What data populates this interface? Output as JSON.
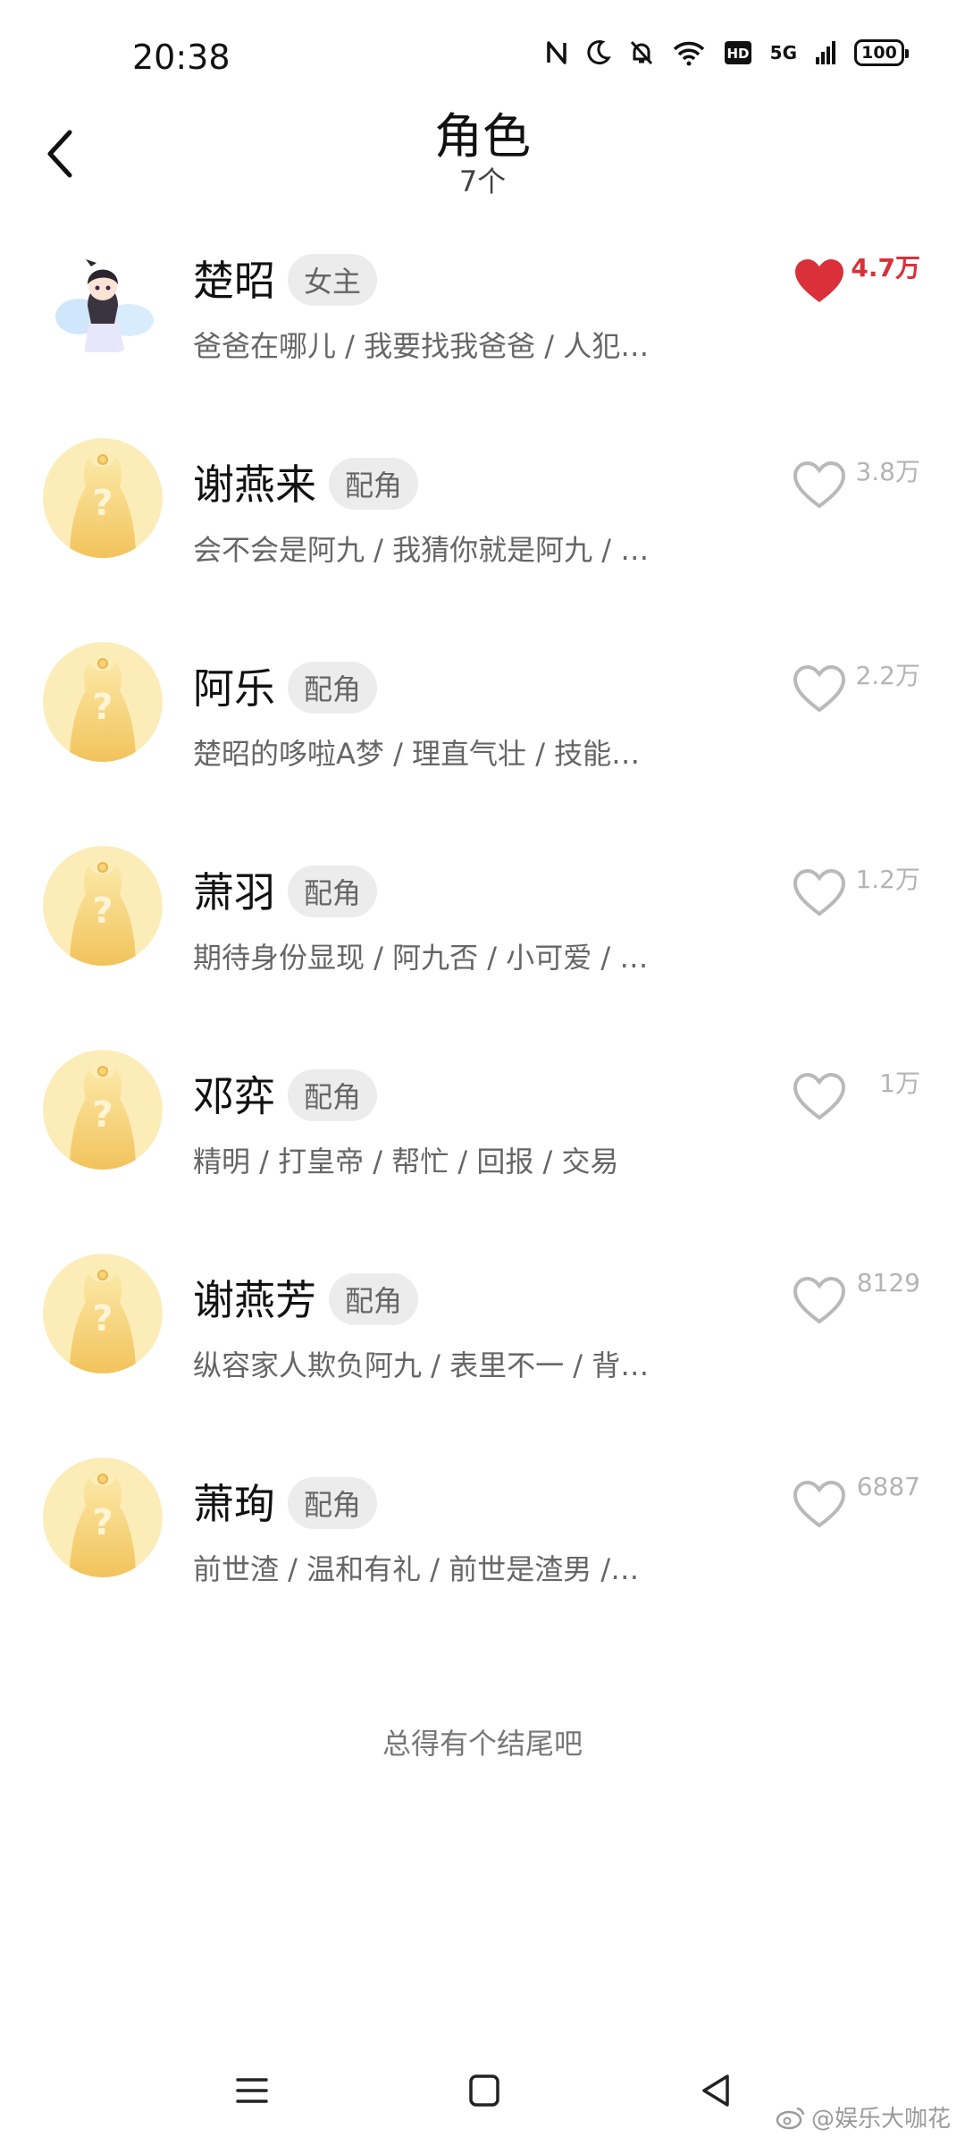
{
  "status_bar": {
    "time": "20:38",
    "network": "5G",
    "hd": "HD",
    "battery": "100"
  },
  "header": {
    "title": "角色",
    "subtitle": "7个"
  },
  "characters": [
    {
      "name": "楚昭",
      "tag": "女主",
      "desc": "爸爸在哪儿 / 我要找我爸爸 / 人犯…",
      "likes": "4.7万",
      "liked": true,
      "avatar": "custom-avatar"
    },
    {
      "name": "谢燕来",
      "tag": "配角",
      "desc": "会不会是阿九 / 我猜你就是阿九 / …",
      "likes": "3.8万",
      "liked": false,
      "avatar": "placeholder-avatar"
    },
    {
      "name": "阿乐",
      "tag": "配角",
      "desc": "楚昭的哆啦A梦 / 理直气壮 / 技能…",
      "likes": "2.2万",
      "liked": false,
      "avatar": "placeholder-avatar"
    },
    {
      "name": "萧羽",
      "tag": "配角",
      "desc": "期待身份显现 / 阿九否 / 小可爱 / …",
      "likes": "1.2万",
      "liked": false,
      "avatar": "placeholder-avatar"
    },
    {
      "name": "邓弈",
      "tag": "配角",
      "desc": "精明 / 打皇帝 / 帮忙 / 回报 / 交易",
      "likes": "1万",
      "liked": false,
      "avatar": "placeholder-avatar"
    },
    {
      "name": "谢燕芳",
      "tag": "配角",
      "desc": "纵容家人欺负阿九 / 表里不一 / 背…",
      "likes": "8129",
      "liked": false,
      "avatar": "placeholder-avatar"
    },
    {
      "name": "萧珣",
      "tag": "配角",
      "desc": "前世渣 / 温和有礼 / 前世是渣男 /…",
      "likes": "6887",
      "liked": false,
      "avatar": "placeholder-avatar"
    }
  ],
  "footer": {
    "text": "总得有个结尾吧"
  },
  "watermark": {
    "text": "@娱乐大咖花"
  },
  "colors": {
    "liked_red": "#d9303a",
    "avatar_yellow": "#f6d27a",
    "tag_bg": "#ececec"
  }
}
